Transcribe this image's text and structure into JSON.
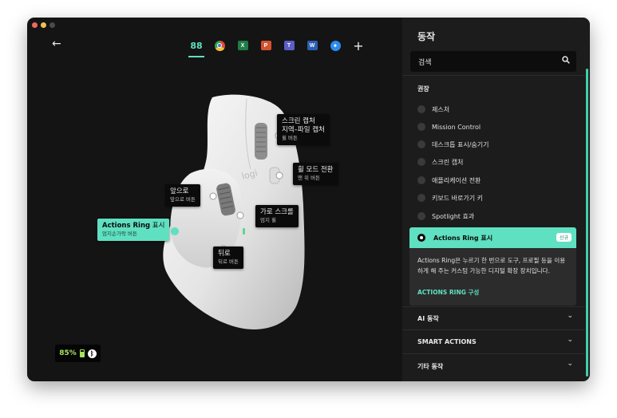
{
  "header": {
    "back_label": "←",
    "add_label": "+"
  },
  "apps": [
    {
      "name": "all-apps",
      "label": "88"
    },
    {
      "name": "chrome",
      "label": ""
    },
    {
      "name": "excel",
      "label": "X"
    },
    {
      "name": "powerpoint",
      "label": "P"
    },
    {
      "name": "teams",
      "label": "T"
    },
    {
      "name": "word",
      "label": "W"
    },
    {
      "name": "safari",
      "label": "✦"
    }
  ],
  "mouse": {
    "logo": "logi"
  },
  "callouts": {
    "screen_capture": {
      "title": "스크린 캡처",
      "title2": "지역–파일 캡처",
      "sub": "휠 버튼"
    },
    "wheel_mode": {
      "title": "휠 모드 전환",
      "sub": "맨 위 버튼"
    },
    "forward": {
      "title": "앞으로",
      "sub": "앞으로 버튼"
    },
    "h_scroll": {
      "title": "가로 스크롤",
      "sub": "엄지 휠"
    },
    "actions_ring": {
      "title_bold": "Actions Ring",
      "title_rest": " 표시",
      "sub": "엄지손가락 버튼"
    },
    "back": {
      "title": "뒤로",
      "sub": "뒤로 버튼"
    }
  },
  "battery": {
    "percent": "85%",
    "accent": "#a8e05f",
    "icon": "battery-icon",
    "conn_icon": "bluetooth-icon"
  },
  "panel": {
    "title": "동작",
    "search_placeholder": "검색",
    "section_recommended": "권장",
    "options": [
      "제스처",
      "Mission Control",
      "데스크톱 표시/숨기기",
      "스크린 캡처",
      "애플리케이션 전환",
      "키보드 바로가기 키",
      "Spotlight 효과"
    ],
    "selected": {
      "label": "Actions Ring 표시",
      "badge": "신규",
      "description": "Actions Ring은 누르기 한 번으로 도구, 프로필 등을 이용하게 해 주는 커스텀 가능한 디지털 확장 장치입니다.",
      "link": "ACTIONS RING 구성"
    },
    "accordions": [
      "AI 동작",
      "SMART ACTIONS",
      "기타 동작"
    ]
  },
  "colors": {
    "accent": "#5fe0c0",
    "bg": "#141414",
    "panel": "#1c1c1c"
  }
}
